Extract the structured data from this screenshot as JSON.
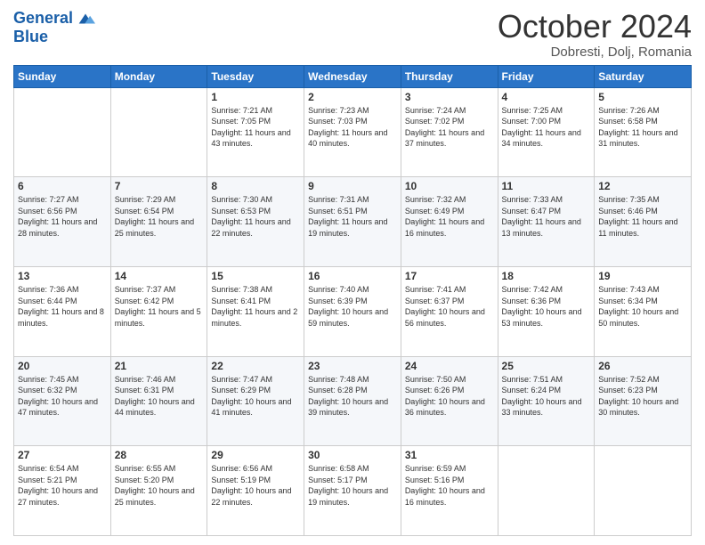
{
  "header": {
    "logo_line1": "General",
    "logo_line2": "Blue",
    "month": "October 2024",
    "location": "Dobresti, Dolj, Romania"
  },
  "weekdays": [
    "Sunday",
    "Monday",
    "Tuesday",
    "Wednesday",
    "Thursday",
    "Friday",
    "Saturday"
  ],
  "weeks": [
    [
      {
        "day": "",
        "sunrise": "",
        "sunset": "",
        "daylight": ""
      },
      {
        "day": "",
        "sunrise": "",
        "sunset": "",
        "daylight": ""
      },
      {
        "day": "1",
        "sunrise": "Sunrise: 7:21 AM",
        "sunset": "Sunset: 7:05 PM",
        "daylight": "Daylight: 11 hours and 43 minutes."
      },
      {
        "day": "2",
        "sunrise": "Sunrise: 7:23 AM",
        "sunset": "Sunset: 7:03 PM",
        "daylight": "Daylight: 11 hours and 40 minutes."
      },
      {
        "day": "3",
        "sunrise": "Sunrise: 7:24 AM",
        "sunset": "Sunset: 7:02 PM",
        "daylight": "Daylight: 11 hours and 37 minutes."
      },
      {
        "day": "4",
        "sunrise": "Sunrise: 7:25 AM",
        "sunset": "Sunset: 7:00 PM",
        "daylight": "Daylight: 11 hours and 34 minutes."
      },
      {
        "day": "5",
        "sunrise": "Sunrise: 7:26 AM",
        "sunset": "Sunset: 6:58 PM",
        "daylight": "Daylight: 11 hours and 31 minutes."
      }
    ],
    [
      {
        "day": "6",
        "sunrise": "Sunrise: 7:27 AM",
        "sunset": "Sunset: 6:56 PM",
        "daylight": "Daylight: 11 hours and 28 minutes."
      },
      {
        "day": "7",
        "sunrise": "Sunrise: 7:29 AM",
        "sunset": "Sunset: 6:54 PM",
        "daylight": "Daylight: 11 hours and 25 minutes."
      },
      {
        "day": "8",
        "sunrise": "Sunrise: 7:30 AM",
        "sunset": "Sunset: 6:53 PM",
        "daylight": "Daylight: 11 hours and 22 minutes."
      },
      {
        "day": "9",
        "sunrise": "Sunrise: 7:31 AM",
        "sunset": "Sunset: 6:51 PM",
        "daylight": "Daylight: 11 hours and 19 minutes."
      },
      {
        "day": "10",
        "sunrise": "Sunrise: 7:32 AM",
        "sunset": "Sunset: 6:49 PM",
        "daylight": "Daylight: 11 hours and 16 minutes."
      },
      {
        "day": "11",
        "sunrise": "Sunrise: 7:33 AM",
        "sunset": "Sunset: 6:47 PM",
        "daylight": "Daylight: 11 hours and 13 minutes."
      },
      {
        "day": "12",
        "sunrise": "Sunrise: 7:35 AM",
        "sunset": "Sunset: 6:46 PM",
        "daylight": "Daylight: 11 hours and 11 minutes."
      }
    ],
    [
      {
        "day": "13",
        "sunrise": "Sunrise: 7:36 AM",
        "sunset": "Sunset: 6:44 PM",
        "daylight": "Daylight: 11 hours and 8 minutes."
      },
      {
        "day": "14",
        "sunrise": "Sunrise: 7:37 AM",
        "sunset": "Sunset: 6:42 PM",
        "daylight": "Daylight: 11 hours and 5 minutes."
      },
      {
        "day": "15",
        "sunrise": "Sunrise: 7:38 AM",
        "sunset": "Sunset: 6:41 PM",
        "daylight": "Daylight: 11 hours and 2 minutes."
      },
      {
        "day": "16",
        "sunrise": "Sunrise: 7:40 AM",
        "sunset": "Sunset: 6:39 PM",
        "daylight": "Daylight: 10 hours and 59 minutes."
      },
      {
        "day": "17",
        "sunrise": "Sunrise: 7:41 AM",
        "sunset": "Sunset: 6:37 PM",
        "daylight": "Daylight: 10 hours and 56 minutes."
      },
      {
        "day": "18",
        "sunrise": "Sunrise: 7:42 AM",
        "sunset": "Sunset: 6:36 PM",
        "daylight": "Daylight: 10 hours and 53 minutes."
      },
      {
        "day": "19",
        "sunrise": "Sunrise: 7:43 AM",
        "sunset": "Sunset: 6:34 PM",
        "daylight": "Daylight: 10 hours and 50 minutes."
      }
    ],
    [
      {
        "day": "20",
        "sunrise": "Sunrise: 7:45 AM",
        "sunset": "Sunset: 6:32 PM",
        "daylight": "Daylight: 10 hours and 47 minutes."
      },
      {
        "day": "21",
        "sunrise": "Sunrise: 7:46 AM",
        "sunset": "Sunset: 6:31 PM",
        "daylight": "Daylight: 10 hours and 44 minutes."
      },
      {
        "day": "22",
        "sunrise": "Sunrise: 7:47 AM",
        "sunset": "Sunset: 6:29 PM",
        "daylight": "Daylight: 10 hours and 41 minutes."
      },
      {
        "day": "23",
        "sunrise": "Sunrise: 7:48 AM",
        "sunset": "Sunset: 6:28 PM",
        "daylight": "Daylight: 10 hours and 39 minutes."
      },
      {
        "day": "24",
        "sunrise": "Sunrise: 7:50 AM",
        "sunset": "Sunset: 6:26 PM",
        "daylight": "Daylight: 10 hours and 36 minutes."
      },
      {
        "day": "25",
        "sunrise": "Sunrise: 7:51 AM",
        "sunset": "Sunset: 6:24 PM",
        "daylight": "Daylight: 10 hours and 33 minutes."
      },
      {
        "day": "26",
        "sunrise": "Sunrise: 7:52 AM",
        "sunset": "Sunset: 6:23 PM",
        "daylight": "Daylight: 10 hours and 30 minutes."
      }
    ],
    [
      {
        "day": "27",
        "sunrise": "Sunrise: 6:54 AM",
        "sunset": "Sunset: 5:21 PM",
        "daylight": "Daylight: 10 hours and 27 minutes."
      },
      {
        "day": "28",
        "sunrise": "Sunrise: 6:55 AM",
        "sunset": "Sunset: 5:20 PM",
        "daylight": "Daylight: 10 hours and 25 minutes."
      },
      {
        "day": "29",
        "sunrise": "Sunrise: 6:56 AM",
        "sunset": "Sunset: 5:19 PM",
        "daylight": "Daylight: 10 hours and 22 minutes."
      },
      {
        "day": "30",
        "sunrise": "Sunrise: 6:58 AM",
        "sunset": "Sunset: 5:17 PM",
        "daylight": "Daylight: 10 hours and 19 minutes."
      },
      {
        "day": "31",
        "sunrise": "Sunrise: 6:59 AM",
        "sunset": "Sunset: 5:16 PM",
        "daylight": "Daylight: 10 hours and 16 minutes."
      },
      {
        "day": "",
        "sunrise": "",
        "sunset": "",
        "daylight": ""
      },
      {
        "day": "",
        "sunrise": "",
        "sunset": "",
        "daylight": ""
      }
    ]
  ]
}
